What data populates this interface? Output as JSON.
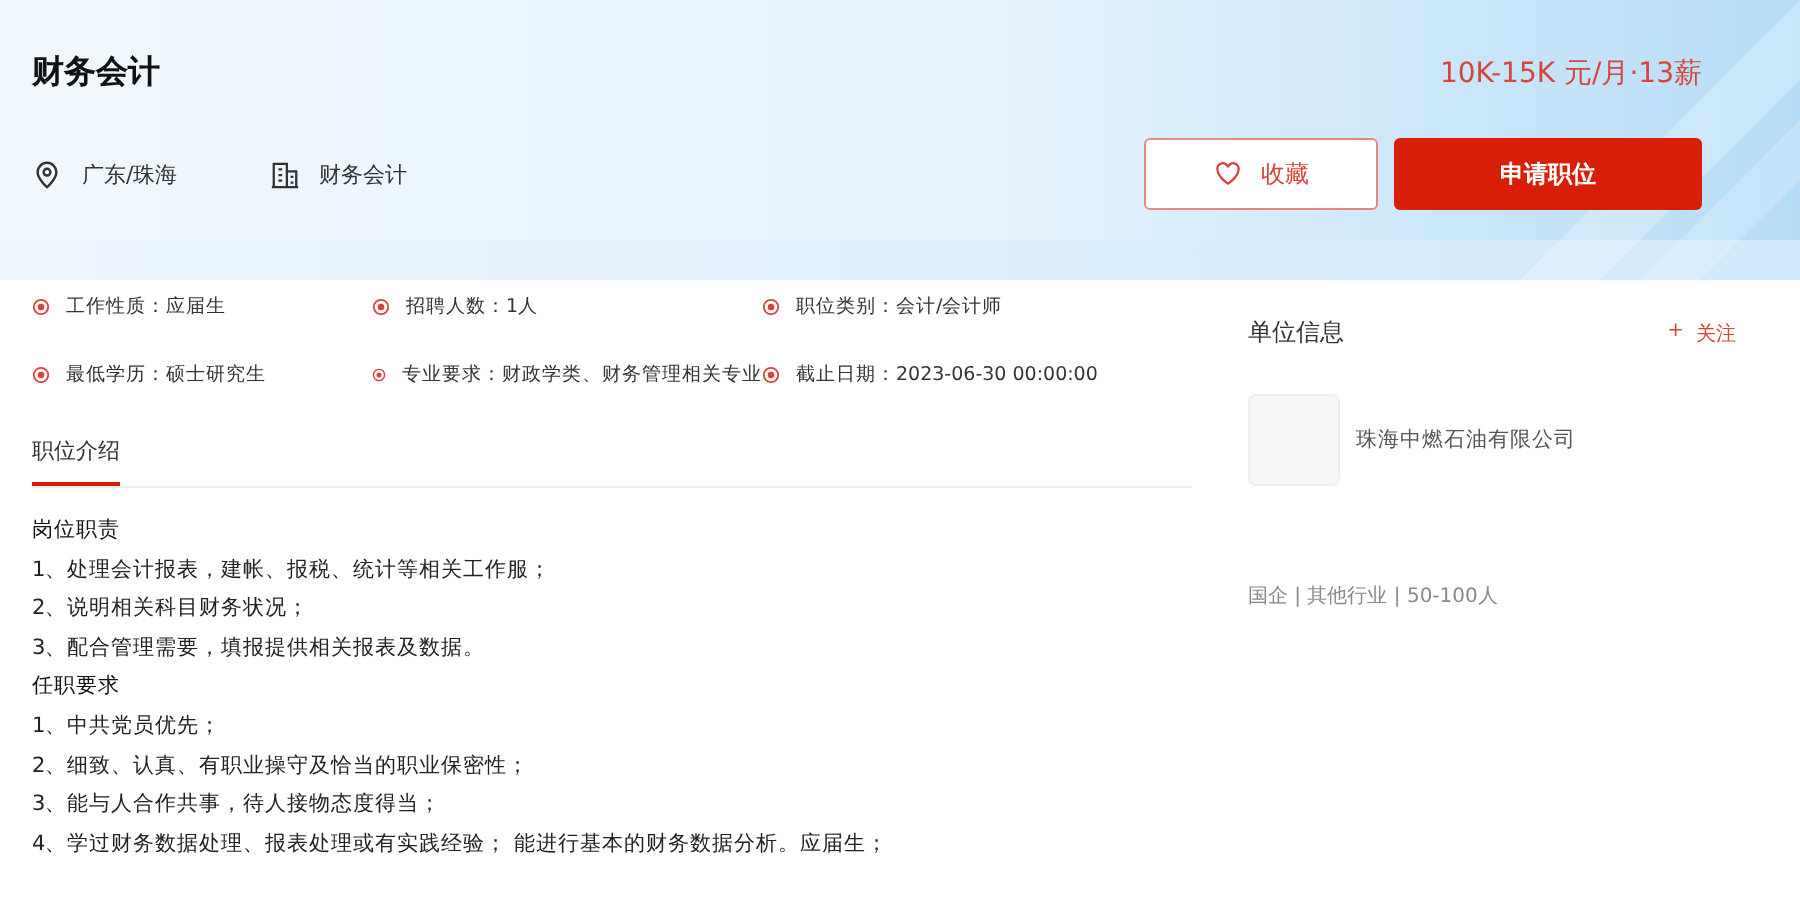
{
  "job": {
    "title": "财务会计",
    "salary": "10K-15K 元/月·13薪",
    "location": "广东/珠海",
    "category": "财务会计"
  },
  "buttons": [
    {
      "label": "收藏",
      "kind": "favorite"
    },
    {
      "label": "申请职位",
      "kind": "apply"
    }
  ],
  "attributes": [
    {
      "label": "工作性质：",
      "value": "应届生"
    },
    {
      "label": "招聘人数：",
      "value": "1人"
    },
    {
      "label": "职位类别：",
      "value": "会计/会计师"
    },
    {
      "label": "最低学历：",
      "value": "硕士研究生"
    },
    {
      "label": "专业要求：",
      "value": "财政学类、财务管理相关专业"
    },
    {
      "label": "截止日期：",
      "value": "2023-06-30 00:00:00"
    }
  ],
  "section_tab": {
    "label": "职位介绍",
    "selected": true
  },
  "description": [
    {
      "kind": "heading",
      "text": "岗位职责"
    },
    {
      "kind": "item",
      "text": "1、处理会计报表，建帐、报税、统计等相关工作服；"
    },
    {
      "kind": "item",
      "text": "2、说明相关科目财务状况；"
    },
    {
      "kind": "item",
      "text": "3、配合管理需要，填报提供相关报表及数据。"
    },
    {
      "kind": "heading",
      "text": "任职要求"
    },
    {
      "kind": "item",
      "text": "1、中共党员优先；"
    },
    {
      "kind": "item",
      "text": "2、细致、认真、有职业操守及恰当的职业保密性；"
    },
    {
      "kind": "item",
      "text": "3、能与人合作共事，待人接物态度得当；"
    },
    {
      "kind": "item",
      "text": "4、学过财务数据处理、报表处理或有实践经验； 能进行基本的财务数据分析。应届生；"
    }
  ],
  "company": {
    "heading": "单位信息",
    "follow": "关注",
    "follow_icon": "+",
    "name": "珠海中燃石油有限公司",
    "meta": "国企 | 其他行业 | 50-100人"
  }
}
